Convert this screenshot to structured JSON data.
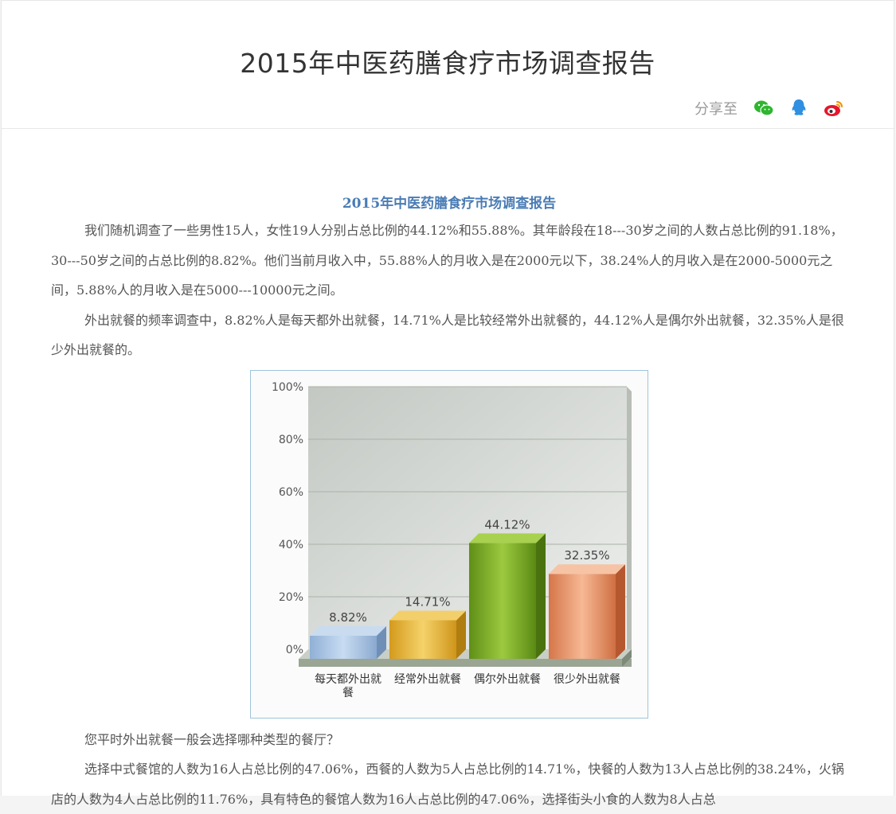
{
  "page": {
    "title": "2015年中医药膳食疗市场调查报告",
    "share_label": "分享至",
    "share_icons": [
      "wechat-icon",
      "qq-icon",
      "weibo-icon"
    ]
  },
  "article": {
    "title": "2015年中医药膳食疗市场调查报告",
    "p1": "我们随机调查了一些男性15人，女性19人分别占总比例的44.12%和55.88%。其年龄段在18---30岁之间的人数占总比例的91.18%，30---50岁之间的占总比例的8.82%。他们当前月收入中，55.88%人的月收入是在2000元以下，38.24%人的月收入是在2000-5000元之间，5.88%人的月收入是在5000---10000元之间。",
    "p2": "外出就餐的频率调查中，8.82%人是每天都外出就餐，14.71%人是比较经常外出就餐的，44.12%人是偶尔外出就餐，32.35%人是很少外出就餐的。",
    "p3": "您平时外出就餐一般会选择哪种类型的餐厅？",
    "p4": "选择中式餐馆的人数为16人占总比例的47.06%，西餐的人数为5人占总比例的14.71%，快餐的人数为13人占总比例的38.24%，火锅店的人数为4人占总比例的11.76%，具有特色的餐馆人数为16人占总比例的47.06%，选择街头小食的人数为8人占总"
  },
  "chart_data": {
    "type": "bar",
    "categories": [
      "每天都外出就餐",
      "经常外出就餐",
      "偶尔外出就餐",
      "很少外出就餐"
    ],
    "values": [
      8.82,
      14.71,
      44.12,
      32.35
    ],
    "value_labels": [
      "8.82%",
      "14.71%",
      "44.12%",
      "32.35%"
    ],
    "y_ticks": [
      "0%",
      "20%",
      "40%",
      "60%",
      "80%",
      "100%"
    ],
    "ylim": [
      0,
      100
    ],
    "grid": true,
    "colors": [
      "#a9c6e6",
      "#e8b93a",
      "#7aa82a",
      "#e8916a"
    ]
  }
}
